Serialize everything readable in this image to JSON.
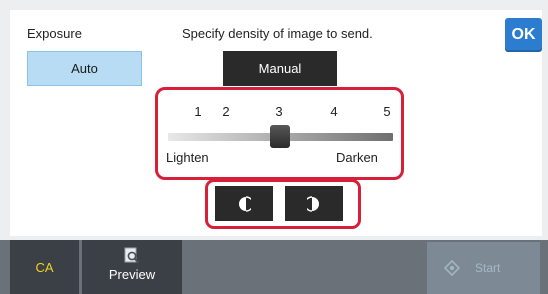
{
  "header": {
    "exposure_label": "Exposure",
    "instruction": "Specify density of image to send.",
    "ok_label": "OK"
  },
  "mode": {
    "auto_label": "Auto",
    "manual_label": "Manual",
    "selected": "Manual"
  },
  "density": {
    "ticks": [
      "1",
      "2",
      "3",
      "4",
      "5"
    ],
    "value": 3,
    "min_label": "Lighten",
    "max_label": "Darken"
  },
  "adjust": {
    "decrease_icon": "half-circle-left-icon",
    "increase_icon": "half-circle-right-icon"
  },
  "bottom_bar": {
    "ca_label": "CA",
    "preview_label": "Preview",
    "preview_icon": "preview-magnifier-icon",
    "start_label": "Start",
    "start_icon": "start-diamond-icon"
  },
  "colors": {
    "accent": "#2c7ccf",
    "highlight_border": "#d81f3a",
    "ca_text": "#f2d21d"
  }
}
